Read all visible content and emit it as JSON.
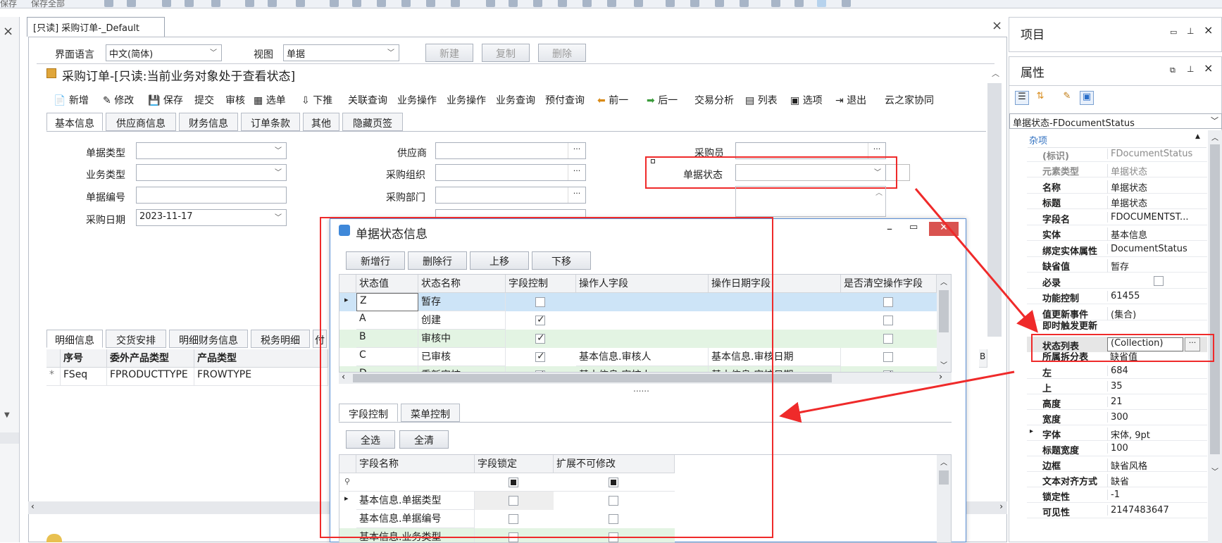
{
  "colors": {
    "red": "#ef2a2a",
    "green_row": "#e3f4e3",
    "blue_row": "#cde4f7",
    "title_bar_close": "#d9534f"
  },
  "doc": {
    "tab_title": "[只读] 采购订单-_Default",
    "lang_label": "界面语言",
    "lang_value": "中文(简体)",
    "view_label": "视图",
    "view_value": "单据",
    "btn_new": "新建",
    "btn_copy": "复制",
    "btn_delete": "删除",
    "form_title": "采购订单-[只读:当前业务对象处于查看状态]",
    "toolbar": [
      "新增",
      "修改",
      "保存",
      "提交",
      "审核",
      "选单",
      "下推",
      "关联查询",
      "业务操作",
      "业务操作",
      "业务查询",
      "预付查询",
      "前一",
      "后一",
      "交易分析",
      "列表",
      "选项",
      "退出",
      "云之家协同"
    ],
    "tabs": [
      "基本信息",
      "供应商信息",
      "财务信息",
      "订单条款",
      "其他",
      "隐藏页签"
    ],
    "fields": {
      "bill_type": "单据类型",
      "biz_type": "业务类型",
      "bill_no": "单据编号",
      "purchase_date": "采购日期",
      "purchase_date_value": "2023-11-17",
      "supplier": "供应商",
      "purchase_org": "采购组织",
      "purchase_dept": "采购部门",
      "buyer": "采购员",
      "doc_status": "单据状态"
    },
    "detail_tabs": [
      "明细信息",
      "交货安排",
      "明细财务信息",
      "税务明细",
      "付"
    ],
    "detail_headers": [
      "序号",
      "委外产品类型",
      "产品类型"
    ],
    "detail_row": [
      "FSeq",
      "FPRODUCTTYPE",
      "FROWTYPE"
    ],
    "detail_row_marker": "*"
  },
  "dialog": {
    "title": "单据状态信息",
    "buttons": [
      "新增行",
      "删除行",
      "上移",
      "下移"
    ],
    "headers": [
      "状态值",
      "状态名称",
      "字段控制",
      "操作人字段",
      "操作日期字段",
      "是否清空操作字段"
    ],
    "rows": [
      {
        "value": "Z",
        "name": "暂存",
        "field_ctrl": false,
        "operator": "",
        "op_date": "",
        "clear": false
      },
      {
        "value": "A",
        "name": "创建",
        "field_ctrl": true,
        "operator": "",
        "op_date": "",
        "clear": false
      },
      {
        "value": "B",
        "name": "审核中",
        "field_ctrl": true,
        "operator": "",
        "op_date": "",
        "clear": false
      },
      {
        "value": "C",
        "name": "已审核",
        "field_ctrl": true,
        "operator": "基本信息.审核人",
        "op_date": "基本信息.审核日期",
        "clear": false
      },
      {
        "value": "D",
        "name": "重新审核",
        "field_ctrl": true,
        "operator": "基本信息.审核人",
        "op_date": "基本信息.审核日期",
        "clear": true
      }
    ],
    "splitter": "......",
    "sub_tabs": [
      "字段控制",
      "菜单控制"
    ],
    "sub_buttons": [
      "全选",
      "全清"
    ],
    "sub_headers": [
      "字段名称",
      "字段锁定",
      "扩展不可修改"
    ],
    "sub_rows": [
      "基本信息.单据类型",
      "基本信息.单据编号",
      "基本信息.业务类型"
    ]
  },
  "project_panel": {
    "title": "项目"
  },
  "props_panel": {
    "title": "属性",
    "selector": "单据状态-FDocumentStatus",
    "category": "杂项",
    "rows": [
      {
        "label": "(标识)",
        "value": "FDocumentStatus",
        "grey": true
      },
      {
        "label": "元素类型",
        "value": "单据状态",
        "grey": true
      },
      {
        "label": "名称",
        "value": "单据状态"
      },
      {
        "label": "标题",
        "value": "单据状态"
      },
      {
        "label": "字段名",
        "value": "FDOCUMENTST..."
      },
      {
        "label": "实体",
        "value": "基本信息"
      },
      {
        "label": "绑定实体属性",
        "value": "DocumentStatus"
      },
      {
        "label": "缺省值",
        "value": "暂存"
      },
      {
        "label": "必录",
        "value": ""
      },
      {
        "label": "功能控制",
        "value": "61455"
      },
      {
        "label": "值更新事件",
        "value": "(集合)"
      },
      {
        "label": "即时触发更新",
        "value": ""
      },
      {
        "label": "状态列表",
        "value": "(Collection)"
      },
      {
        "label": "所属拆分表",
        "value": "缺省值"
      },
      {
        "label": "左",
        "value": "684"
      },
      {
        "label": "上",
        "value": "35"
      },
      {
        "label": "高度",
        "value": "21"
      },
      {
        "label": "宽度",
        "value": "300"
      },
      {
        "label": "字体",
        "value": "宋体, 9pt"
      },
      {
        "label": "标题宽度",
        "value": "100"
      },
      {
        "label": "边框",
        "value": "缺省风格"
      },
      {
        "label": "文本对齐方式",
        "value": "缺省"
      },
      {
        "label": "锁定性",
        "value": "-1"
      },
      {
        "label": "可见性",
        "value": "2147483647"
      }
    ]
  }
}
